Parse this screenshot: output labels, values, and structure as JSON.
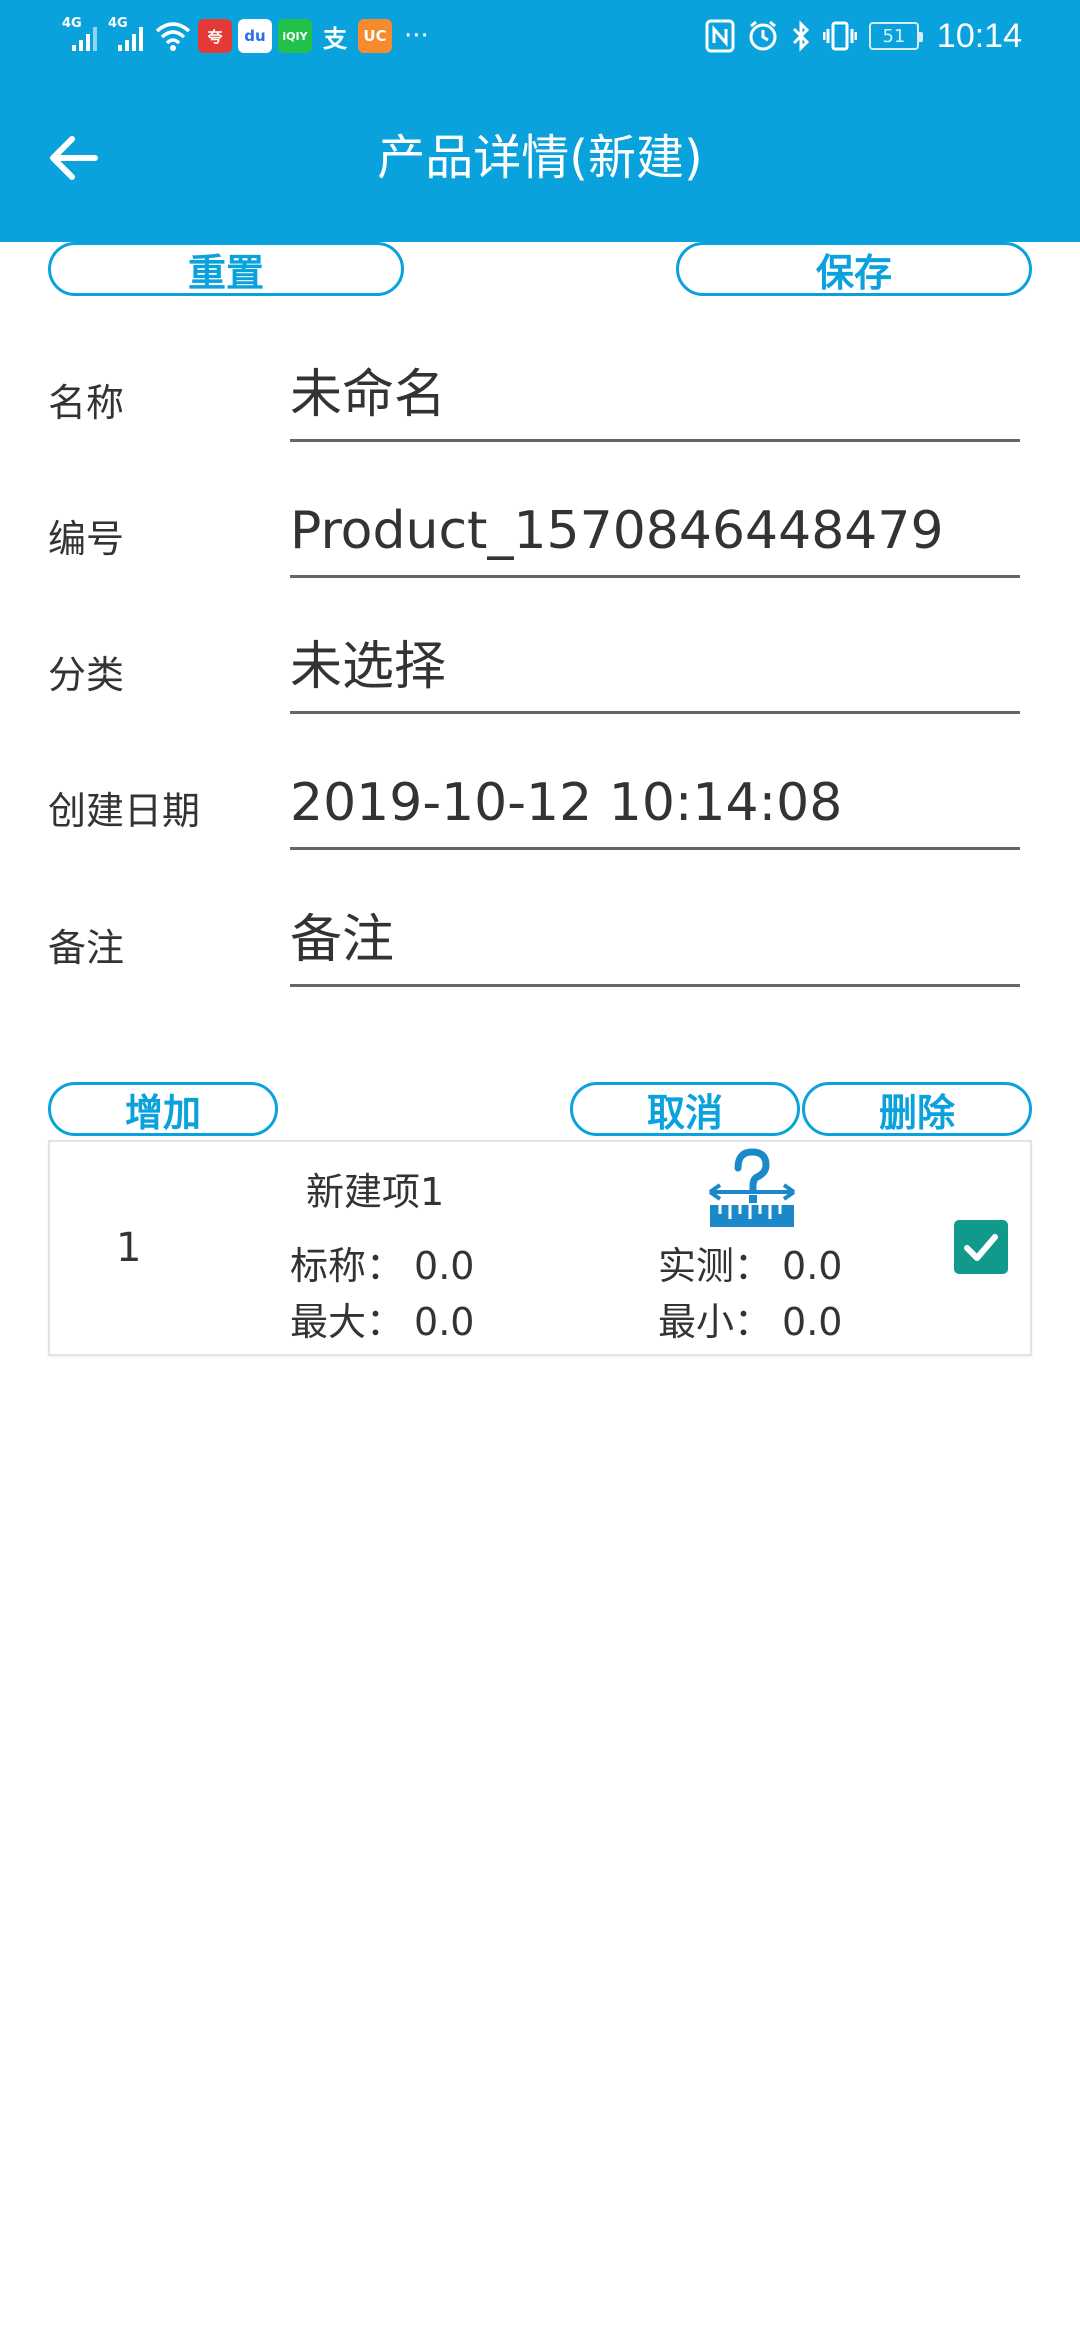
{
  "status_bar": {
    "signal_1_label": "4G",
    "signal_2_label": "4G",
    "app_icons": [
      "app-icon-red",
      "baidu-icon",
      "iqiyi-icon",
      "alipay-icon",
      "uc-browser-icon"
    ],
    "app_icon_texts": [
      "夸",
      "du",
      "iQIY",
      "支",
      "UC"
    ],
    "more": "···",
    "battery_level": "51",
    "time": "10:14"
  },
  "header": {
    "title": "产品详情(新建)",
    "background": "#0aa2dd"
  },
  "top_actions": {
    "reset_label": "重置",
    "save_label": "保存"
  },
  "form": {
    "name": {
      "label": "名称",
      "value": "未命名"
    },
    "code": {
      "label": "编号",
      "value": "Product_1570846448479"
    },
    "category": {
      "label": "分类",
      "value": "未选择"
    },
    "created": {
      "label": "创建日期",
      "value": "2019-10-12 10:14:08"
    },
    "notes": {
      "label": "备注",
      "value": "备注"
    }
  },
  "list_actions": {
    "add_label": "增加",
    "cancel_label": "取消",
    "delete_label": "删除"
  },
  "items": [
    {
      "index": "1",
      "name": "新建项1",
      "nominal_label": "标称：",
      "nominal_value": "0.0",
      "measured_label": "实测：",
      "measured_value": "0.0",
      "max_label": "最大：",
      "max_value": "0.0",
      "min_label": "最小：",
      "min_value": "0.0",
      "checked": true
    }
  ],
  "colors": {
    "accent": "#0aa2dd",
    "checkbox": "#119a8c",
    "text": "#333333"
  }
}
